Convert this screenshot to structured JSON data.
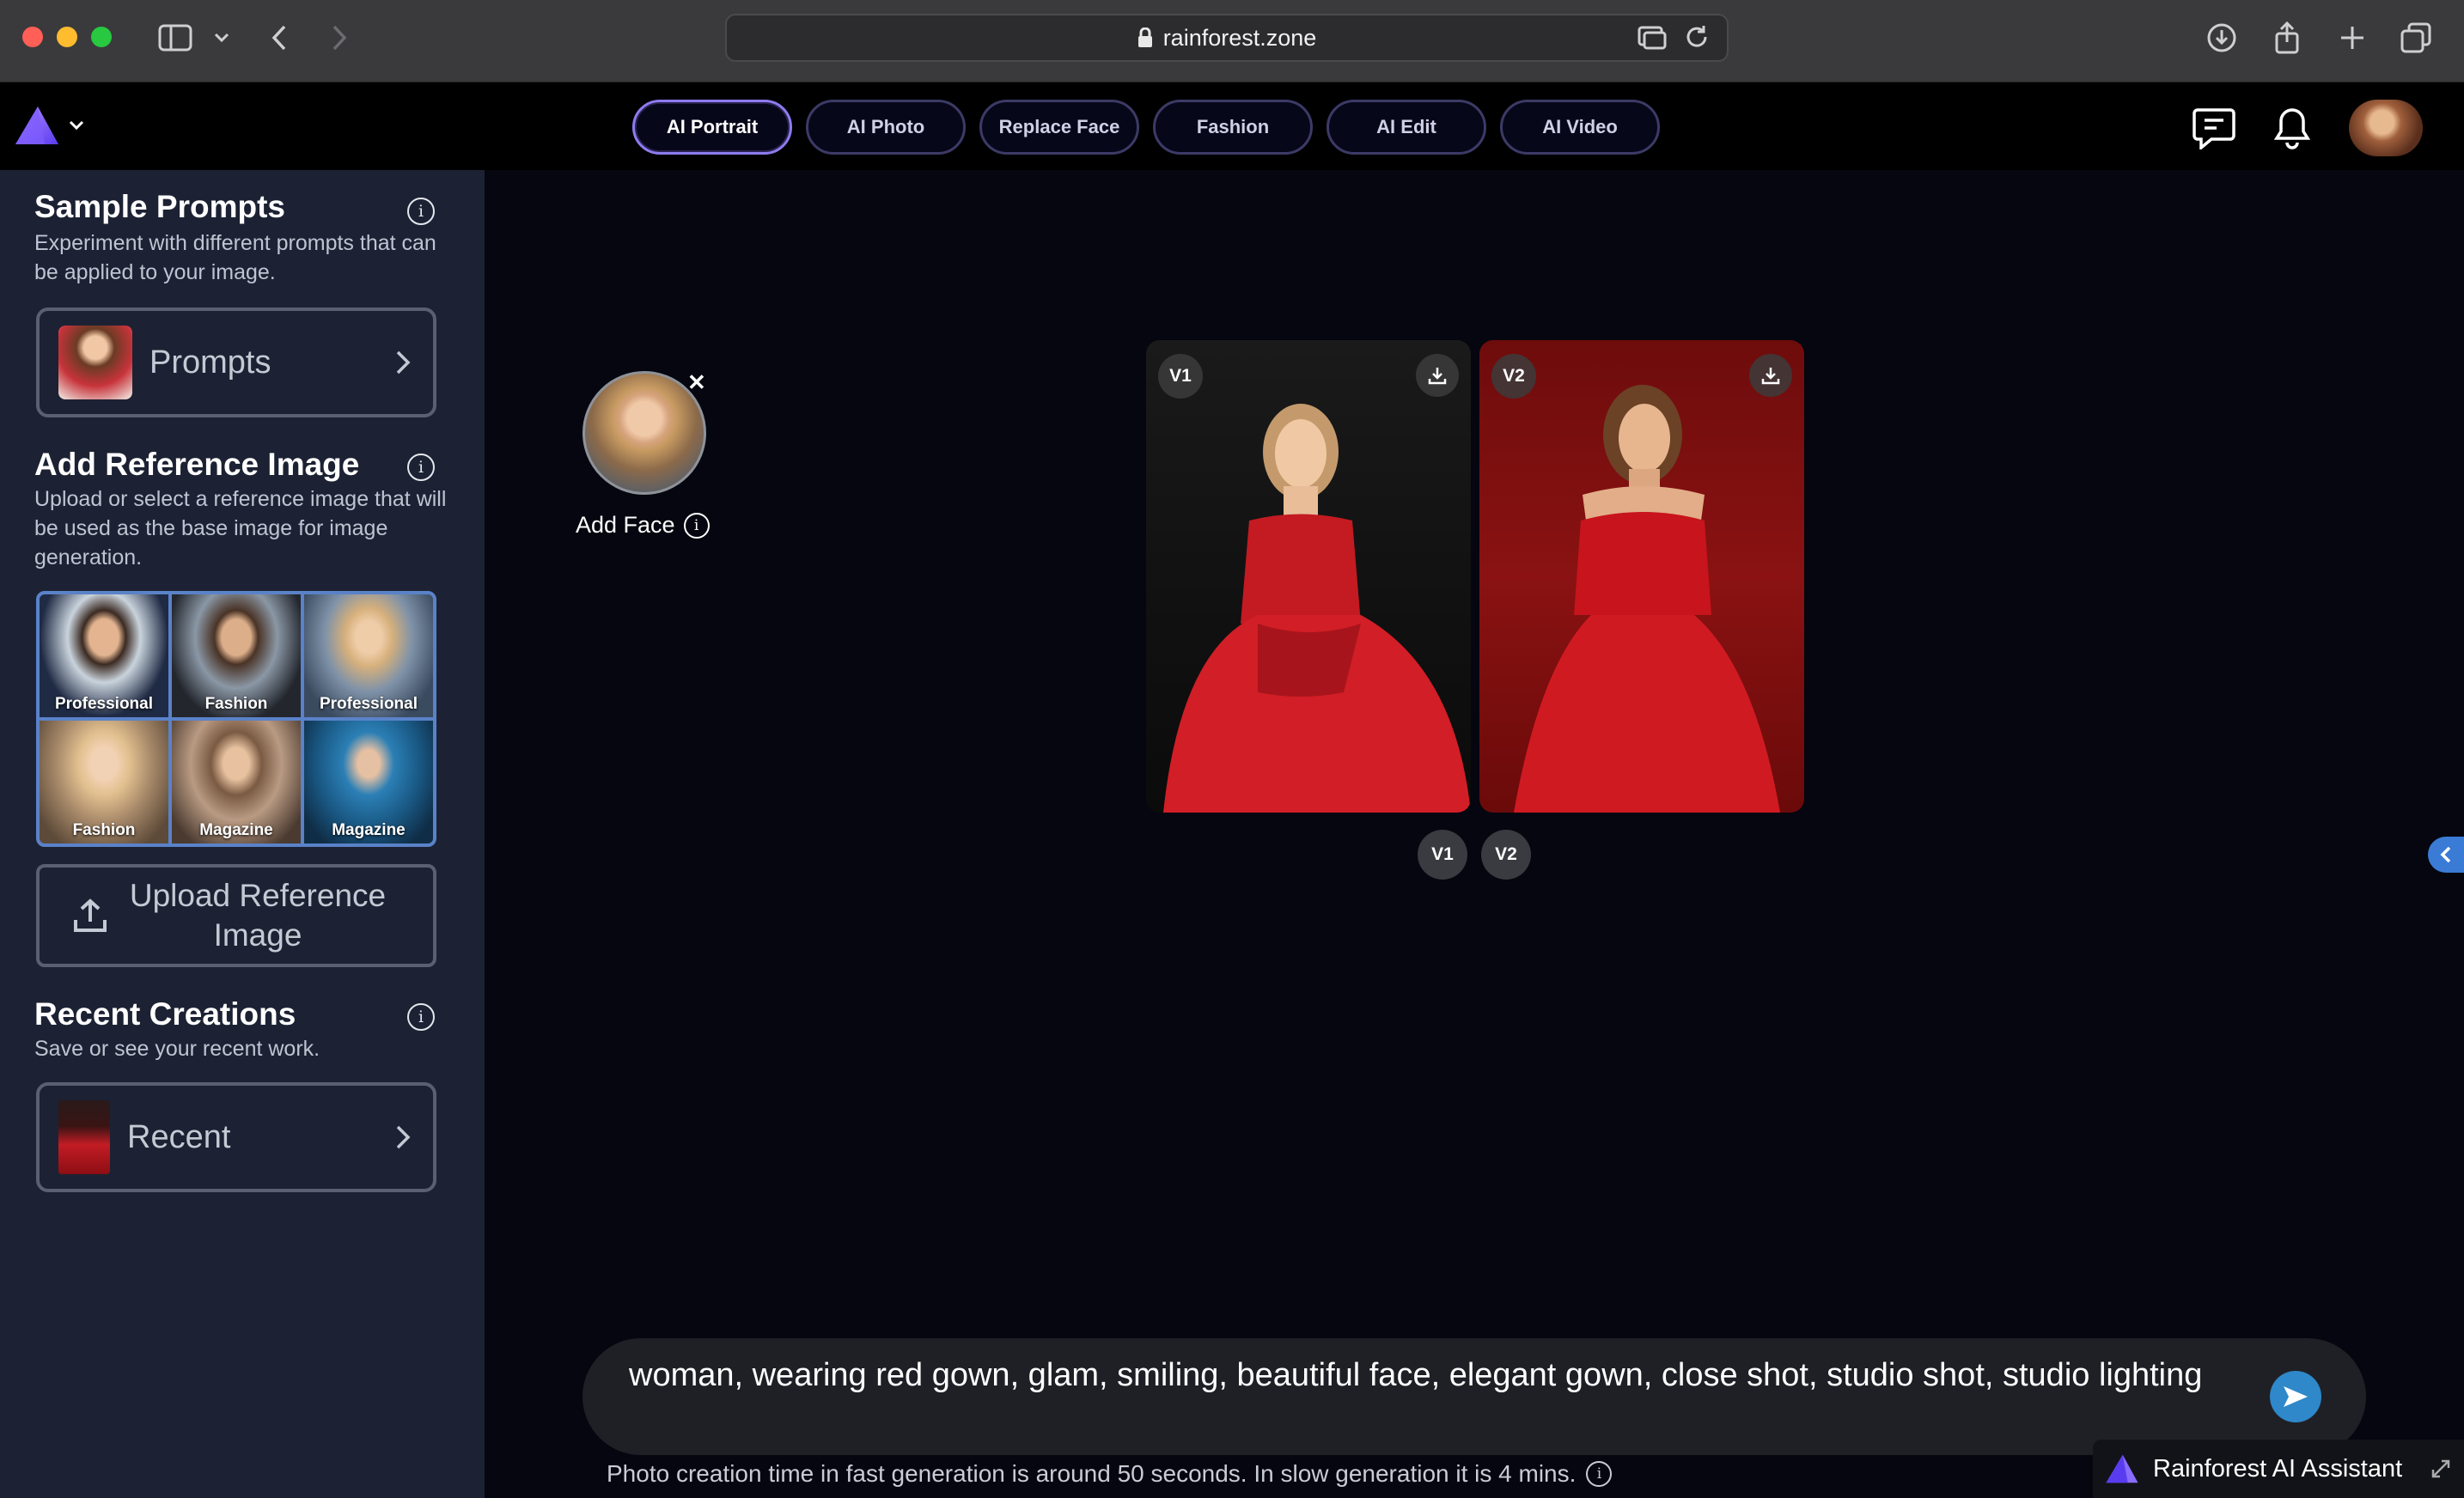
{
  "browser": {
    "url": "rainforest.zone"
  },
  "header": {
    "tabs": [
      {
        "label": "AI Portrait",
        "active": true
      },
      {
        "label": "AI Photo",
        "active": false
      },
      {
        "label": "Replace Face",
        "active": false
      },
      {
        "label": "Fashion",
        "active": false
      },
      {
        "label": "AI Edit",
        "active": false
      },
      {
        "label": "AI Video",
        "active": false
      }
    ]
  },
  "sidebar": {
    "sample_prompts": {
      "title": "Sample Prompts",
      "description": "Experiment with different prompts that can be applied to your image.",
      "button_label": "Prompts"
    },
    "reference": {
      "title": "Add Reference Image",
      "description": "Upload or select a reference image that will be used as the base image for image generation.",
      "thumbs": [
        {
          "label": "Professional"
        },
        {
          "label": "Fashion"
        },
        {
          "label": "Professional"
        },
        {
          "label": "Fashion"
        },
        {
          "label": "Magazine"
        },
        {
          "label": "Magazine"
        }
      ],
      "upload_label": "Upload Reference Image"
    },
    "recent": {
      "title": "Recent Creations",
      "description": "Save or see your recent work.",
      "button_label": "Recent"
    }
  },
  "main": {
    "face_label": "Add Face",
    "results": [
      {
        "badge": "V1"
      },
      {
        "badge": "V2"
      }
    ],
    "pager": [
      "V1",
      "V2"
    ],
    "prompt": "woman, wearing red gown, glam, smiling, beautiful face,  elegant gown,  close shot, studio shot, studio lighting",
    "footnote": "Photo creation time in fast generation is around 50 seconds. In slow generation it is 4 mins."
  },
  "assistant": {
    "label": "Rainforest AI Assistant"
  },
  "colors": {
    "accent": "#8d7cf0",
    "sidebar_bg": "#1c2233",
    "main_bg": "#05060f",
    "send_button": "#2e88c9"
  }
}
